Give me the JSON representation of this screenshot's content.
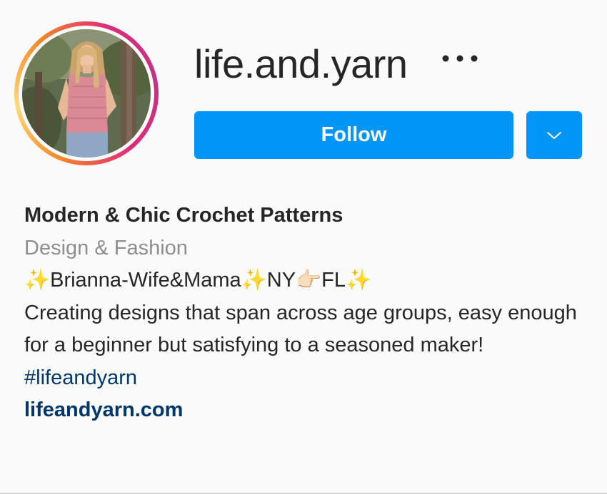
{
  "profile": {
    "username": "life.and.yarn",
    "follow_label": "Follow",
    "more_icon": "more-options-icon",
    "dropdown_icon": "chevron-down-icon"
  },
  "bio": {
    "display_name": "Modern & Chic Crochet Patterns",
    "category": "Design & Fashion",
    "tagline": "✨Brianna-Wife&Mama✨NY👉🏻FL✨",
    "description": "Creating designs that span across age groups, easy enough for a beginner but satisfying to a seasoned maker!",
    "hashtag": "#lifeandyarn",
    "website": "lifeandyarn.com"
  },
  "colors": {
    "accent": "#0095f6",
    "link": "#00376b",
    "muted": "#8e8e8e",
    "text": "#262626"
  }
}
